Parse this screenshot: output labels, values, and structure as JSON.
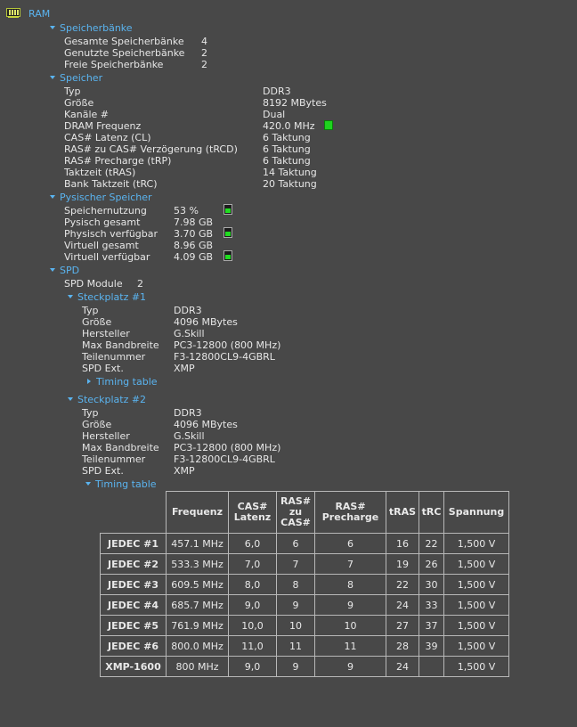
{
  "root": {
    "label": "RAM"
  },
  "sections": {
    "banks": {
      "title": "Speicherbänke",
      "rows": [
        {
          "label": "Gesamte Speicherbänke",
          "value": "4"
        },
        {
          "label": "Genutzte Speicherbänke",
          "value": "2"
        },
        {
          "label": "Freie Speicherbänke",
          "value": "2"
        }
      ]
    },
    "memory": {
      "title": "Speicher",
      "rows": [
        {
          "label": "Typ",
          "value": "DDR3"
        },
        {
          "label": "Größe",
          "value": "8192 MBytes"
        },
        {
          "label": "Kanäle #",
          "value": "Dual"
        },
        {
          "label": "DRAM Frequenz",
          "value": "420.0 MHz"
        },
        {
          "label": "CAS# Latenz (CL)",
          "value": "6 Taktung"
        },
        {
          "label": "RAS# zu CAS# Verzögerung (tRCD)",
          "value": "6 Taktung"
        },
        {
          "label": "RAS# Precharge (tRP)",
          "value": "6 Taktung"
        },
        {
          "label": "Taktzeit (tRAS)",
          "value": "14 Taktung"
        },
        {
          "label": "Bank Taktzeit (tRC)",
          "value": "20 Taktung"
        }
      ]
    },
    "physical": {
      "title": "Pysischer Speicher",
      "rows": [
        {
          "label": "Speichernutzung",
          "value": "53 %",
          "gauge": 0.53
        },
        {
          "label": "Pysisch gesamt",
          "value": "7.98 GB"
        },
        {
          "label": "Physisch verfügbar",
          "value": "3.70 GB",
          "gauge": 0.46
        },
        {
          "label": "Virtuell gesamt",
          "value": "8.96 GB"
        },
        {
          "label": "Virtuell verfügbar",
          "value": "4.09 GB",
          "gauge": 0.46
        }
      ]
    },
    "spd": {
      "title": "SPD",
      "modules_label": "SPD Module",
      "modules_value": "2",
      "slots": [
        {
          "title": "Steckplatz #1",
          "rows": [
            {
              "label": "Typ",
              "value": "DDR3"
            },
            {
              "label": "Größe",
              "value": "4096 MBytes"
            },
            {
              "label": "Hersteller",
              "value": "G.Skill"
            },
            {
              "label": "Max Bandbreite",
              "value": "PC3-12800 (800 MHz)"
            },
            {
              "label": "Teilenummer",
              "value": "F3-12800CL9-4GBRL"
            },
            {
              "label": "SPD Ext.",
              "value": "XMP"
            }
          ],
          "timing_label": "Timing table"
        },
        {
          "title": "Steckplatz #2",
          "rows": [
            {
              "label": "Typ",
              "value": "DDR3"
            },
            {
              "label": "Größe",
              "value": "4096 MBytes"
            },
            {
              "label": "Hersteller",
              "value": "G.Skill"
            },
            {
              "label": "Max Bandbreite",
              "value": "PC3-12800 (800 MHz)"
            },
            {
              "label": "Teilenummer",
              "value": "F3-12800CL9-4GBRL"
            },
            {
              "label": "SPD Ext.",
              "value": "XMP"
            }
          ],
          "timing_label": "Timing table"
        }
      ]
    }
  },
  "timing_table": {
    "headers": [
      "Frequenz",
      "CAS#\nLatenz",
      "RAS#\nzu\nCAS#",
      "RAS#\nPrecharge",
      "tRAS",
      "tRC",
      "Spannung"
    ],
    "rows": [
      [
        "JEDEC #1",
        "457.1 MHz",
        "6,0",
        "6",
        "6",
        "16",
        "22",
        "1,500 V"
      ],
      [
        "JEDEC #2",
        "533.3 MHz",
        "7,0",
        "7",
        "7",
        "19",
        "26",
        "1,500 V"
      ],
      [
        "JEDEC #3",
        "609.5 MHz",
        "8,0",
        "8",
        "8",
        "22",
        "30",
        "1,500 V"
      ],
      [
        "JEDEC #4",
        "685.7 MHz",
        "9,0",
        "9",
        "9",
        "24",
        "33",
        "1,500 V"
      ],
      [
        "JEDEC #5",
        "761.9 MHz",
        "10,0",
        "10",
        "10",
        "27",
        "37",
        "1,500 V"
      ],
      [
        "JEDEC #6",
        "800.0 MHz",
        "11,0",
        "11",
        "11",
        "28",
        "39",
        "1,500 V"
      ],
      [
        "XMP-1600",
        "800 MHz",
        "9,0",
        "9",
        "9",
        "24",
        "",
        "1,500 V"
      ]
    ]
  },
  "colors": {
    "background": "#484848",
    "header": "#5ab4f0",
    "text": "#e6e6e6",
    "indicator": "#1ed41e"
  }
}
